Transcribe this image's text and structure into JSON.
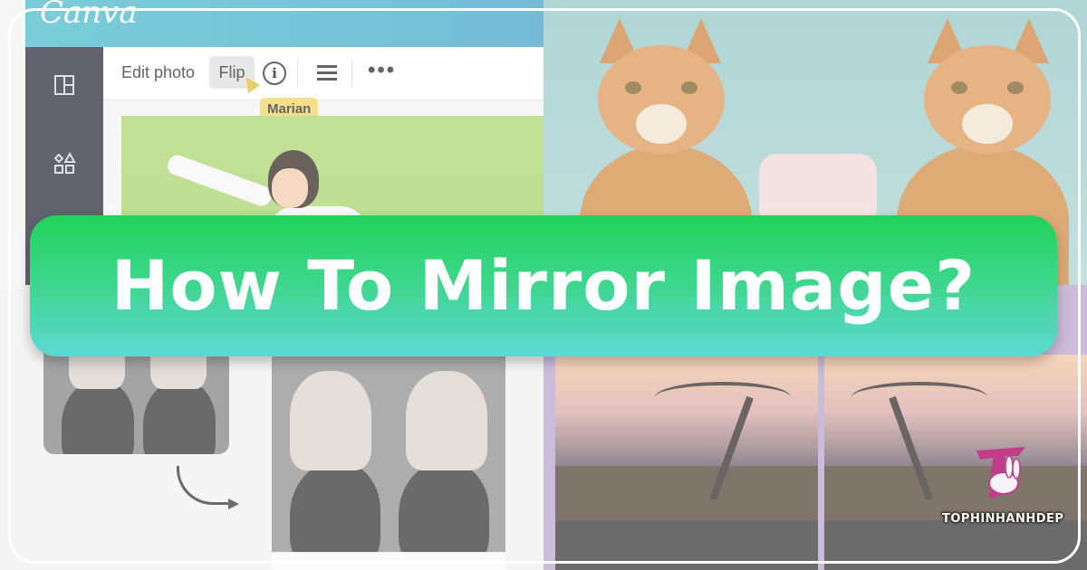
{
  "canva": {
    "logo": "Canva",
    "toolbar": {
      "edit_label": "Edit photo",
      "flip_label": "Flip",
      "info_glyph": "i",
      "more_glyph": "•••"
    },
    "cursor_tag": "Marian"
  },
  "banner": {
    "title": "How To Mirror Image?"
  },
  "brand": {
    "name": "TOPHINHANHDEP",
    "accent": "#c23c8a"
  },
  "colors": {
    "banner_top": "#22d35a",
    "banner_bottom": "#5dd8d4",
    "canva_teal": "#3fb8c8",
    "frame": "#ffffff"
  },
  "icons": [
    "layout-icon",
    "elements-icon",
    "info-icon",
    "menu-icon",
    "more-icon",
    "cursor-arrow-icon",
    "curved-arrow-icon"
  ]
}
